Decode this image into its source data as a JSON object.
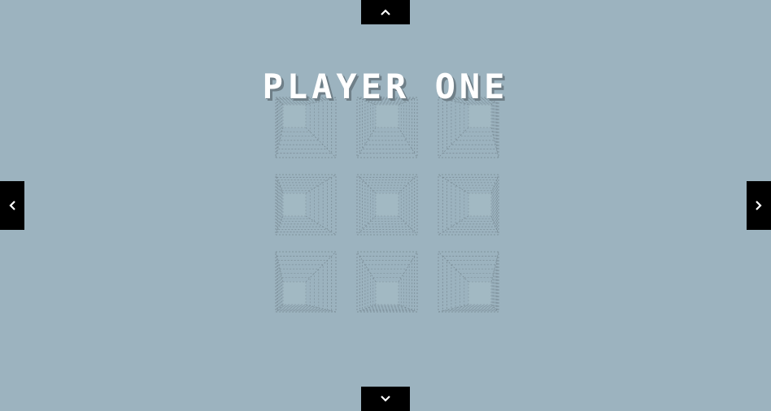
{
  "title": "PLAYER ONE",
  "nav": {
    "up": "chevron-up",
    "down": "chevron-down",
    "left": "chevron-left",
    "right": "chevron-right"
  },
  "colors": {
    "background": "#9cb3bf",
    "button": "#000000",
    "title": "#ffffff",
    "title_shadow": "#6f7f88",
    "wire": "#6f7f88"
  },
  "tunnels": [
    {
      "id": "tl",
      "dir": [
        -1,
        -1
      ]
    },
    {
      "id": "tc",
      "dir": [
        0,
        -1
      ]
    },
    {
      "id": "tr",
      "dir": [
        1,
        -1
      ]
    },
    {
      "id": "ml",
      "dir": [
        -1,
        0
      ]
    },
    {
      "id": "mc",
      "dir": [
        0,
        0
      ]
    },
    {
      "id": "mr",
      "dir": [
        1,
        0
      ]
    },
    {
      "id": "bl",
      "dir": [
        -1,
        1
      ]
    },
    {
      "id": "bc",
      "dir": [
        0,
        1
      ]
    },
    {
      "id": "br",
      "dir": [
        1,
        1
      ]
    }
  ]
}
